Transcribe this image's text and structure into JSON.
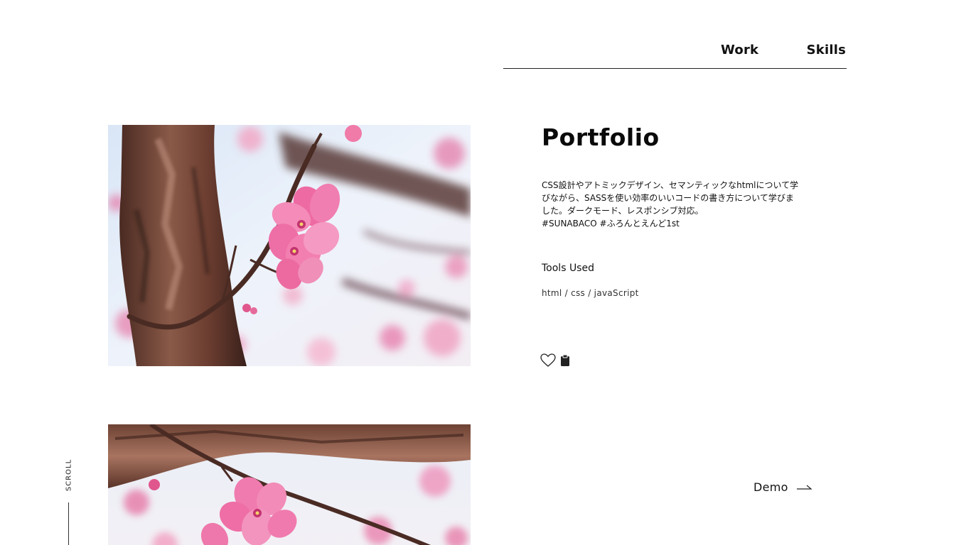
{
  "nav": {
    "work_label": "Work",
    "skills_label": "Skills"
  },
  "project": {
    "title": "Portfolio",
    "description_lines": [
      "CSS設計やアトミックデザイン、セマンティックなhtmlについて学",
      "びながら、SASSを使い効率のいいコードの書き方について学びま",
      "した。ダークモード、レスポンシブ対応。",
      "#SUNABACO #ふろんとえんど1st"
    ],
    "tools_heading": "Tools Used",
    "tools_list": "html / css / javaScript",
    "icons": [
      "heart-icon",
      "clipboard-icon"
    ]
  },
  "demo": {
    "label": "Demo",
    "icon": "arrow-right-icon"
  },
  "scroll": {
    "label": "SCROLL"
  }
}
